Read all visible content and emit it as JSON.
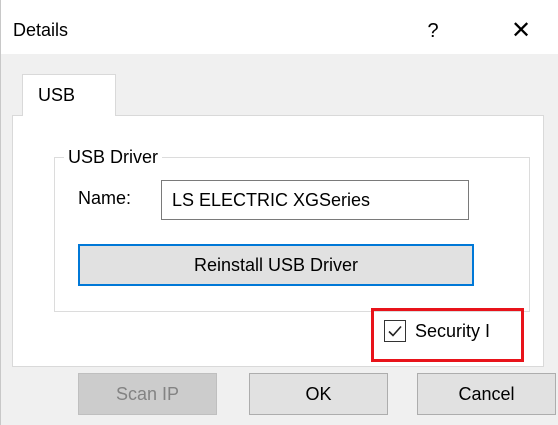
{
  "window": {
    "title": "Details",
    "help_glyph": "?",
    "close_glyph": "✕"
  },
  "tabs": [
    {
      "label": "USB",
      "active": true
    }
  ],
  "usb_group": {
    "legend": "USB Driver",
    "name_label": "Name:",
    "name_value": "LS ELECTRIC XGSeries",
    "reinstall_label": "Reinstall USB Driver"
  },
  "security": {
    "label": "Security I",
    "checked": true,
    "highlight_color": "#e8131a"
  },
  "buttons": {
    "scan_ip": "Scan IP",
    "ok": "OK",
    "cancel": "Cancel"
  },
  "icons": {
    "help": "help-icon",
    "close": "close-icon",
    "checkmark": "checkmark-icon"
  },
  "colors": {
    "focus_border": "#0078d7",
    "dialog_bg": "#f0f0f0",
    "panel_bg": "#ffffff"
  }
}
